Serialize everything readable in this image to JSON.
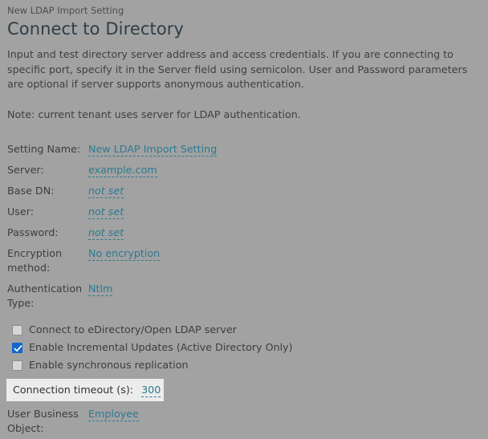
{
  "breadcrumb": "New LDAP Import Setting",
  "title": "Connect to Directory",
  "description": "Input and test directory server address and access credentials. If you are connecting to specific port, specify it in the Server field using semicolon. User and Password parameters are optional if server supports anonymous authentication.",
  "note": "Note: current tenant uses server for LDAP authentication.",
  "colors": {
    "background": "#a2a2a2",
    "link": "#2c7a90",
    "title": "#2f3d46",
    "checkbox_checked": "#1267cf",
    "row_highlight": "#ececec"
  },
  "fields": [
    {
      "label": "Setting Name:",
      "value": "New LDAP Import Setting",
      "italic": false
    },
    {
      "label": "Server:",
      "value": "example.com",
      "italic": false
    },
    {
      "label": "Base DN:",
      "value": "not set",
      "italic": true
    },
    {
      "label": "User:",
      "value": "not set",
      "italic": true
    },
    {
      "label": "Password:",
      "value": "not set",
      "italic": true
    },
    {
      "label": "Encryption method:",
      "value": "No encryption",
      "italic": false
    },
    {
      "label": "Authentication Type:",
      "value": "Ntlm",
      "italic": false
    }
  ],
  "checkboxes": [
    {
      "label": "Connect to eDirectory/Open LDAP server",
      "checked": false
    },
    {
      "label": "Enable Incremental Updates (Active Directory Only)",
      "checked": true
    },
    {
      "label": "Enable synchronous replication",
      "checked": false
    }
  ],
  "timeout_row": {
    "label": "Connection timeout (s):",
    "value": "300"
  },
  "business_object_row": {
    "label": "User Business Object:",
    "value": "Employee"
  },
  "icons": {
    "checkmark": "check-icon"
  }
}
